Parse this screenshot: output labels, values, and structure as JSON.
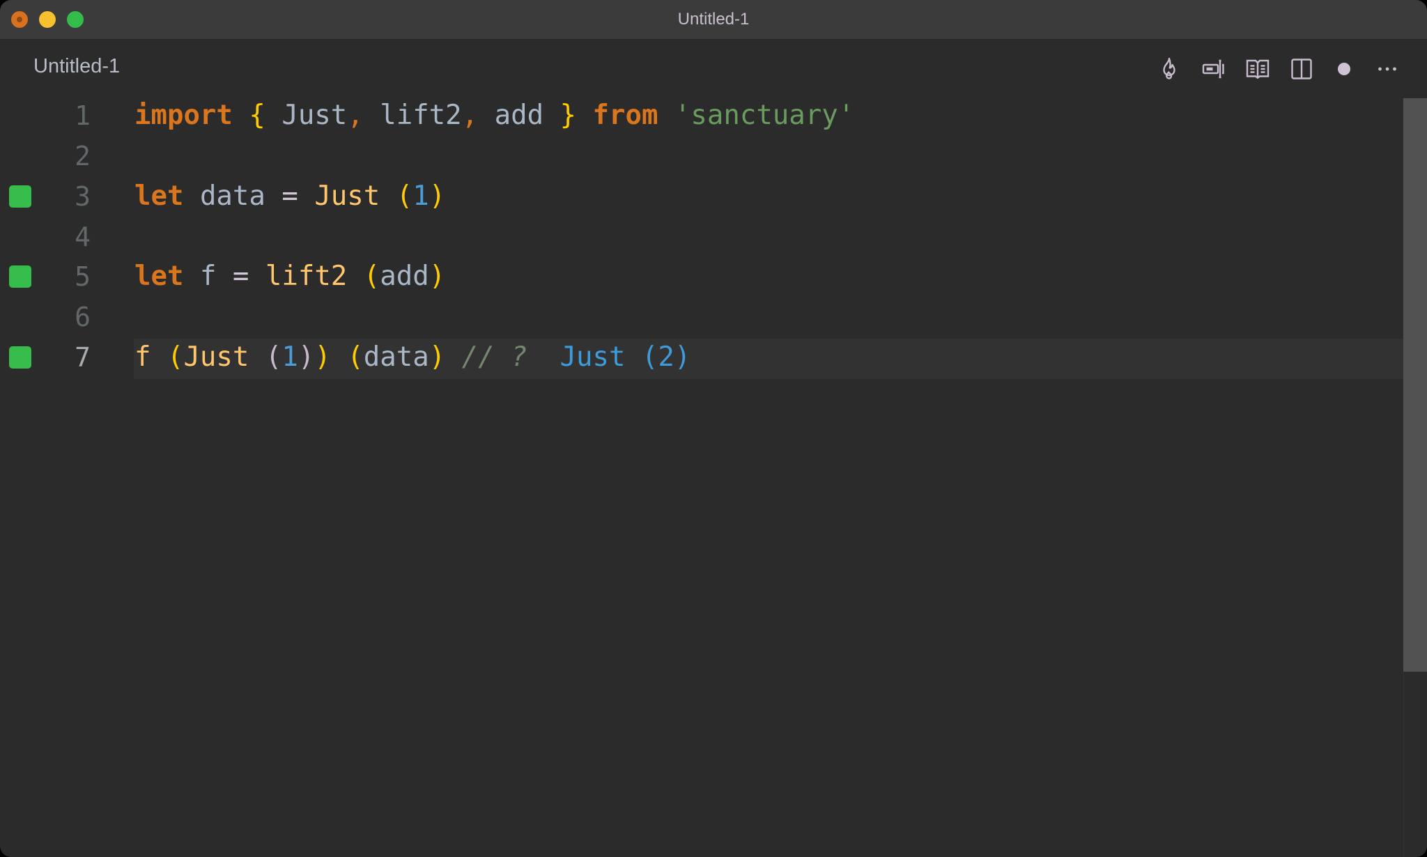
{
  "window": {
    "title": "Untitled-1",
    "controls": [
      "close",
      "minimize",
      "maximize"
    ]
  },
  "tab": {
    "label": "Untitled-1"
  },
  "toolbar": {
    "icons": [
      "flame-icon",
      "text-cursor-box-icon",
      "book-open-icon",
      "split-editor-icon",
      "unsaved-dot-icon",
      "more-icon"
    ]
  },
  "editor": {
    "current_line": 7,
    "lines": [
      {
        "number": "1",
        "marker": false,
        "text": "import { Just, lift2, add } from 'sanctuary'"
      },
      {
        "number": "2",
        "marker": false,
        "text": ""
      },
      {
        "number": "3",
        "marker": true,
        "text": "let data = Just (1)"
      },
      {
        "number": "4",
        "marker": false,
        "text": ""
      },
      {
        "number": "5",
        "marker": true,
        "text": "let f = lift2 (add)"
      },
      {
        "number": "6",
        "marker": false,
        "text": ""
      },
      {
        "number": "7",
        "marker": true,
        "text": "f (Just (1)) (data) // ?  Just (2)"
      }
    ],
    "tokens": {
      "l1": [
        "import",
        " ",
        "{",
        " ",
        "Just",
        ",",
        " ",
        "lift2",
        ",",
        " ",
        "add",
        " ",
        "}",
        " ",
        "from",
        " ",
        "'sanctuary'"
      ],
      "l3": [
        "let",
        " ",
        "data",
        " ",
        "=",
        " ",
        "Just",
        " ",
        "(",
        "1",
        ")"
      ],
      "l5": [
        "let",
        " ",
        "f",
        " ",
        "=",
        " ",
        "lift2",
        " ",
        "(",
        "add",
        ")"
      ],
      "l7": [
        "f",
        " ",
        "(",
        "Just",
        " ",
        "(",
        "1",
        ")",
        ")",
        " ",
        "(",
        "data",
        ")",
        " ",
        "// ?",
        "  ",
        "Just (2)"
      ]
    },
    "inline_result": "Just (2)"
  },
  "colors": {
    "background": "#2b2b2b",
    "titlebar": "#3b3b3b",
    "keyword": "#d9761e",
    "function": "#ffc66d",
    "identifier": "#a9b7c6",
    "string": "#6a9b5f",
    "number": "#4a9dd6",
    "bracket": "#ffcc00",
    "comment": "#75866f",
    "result": "#3e9ad8",
    "marker_green": "#37bd4b"
  }
}
